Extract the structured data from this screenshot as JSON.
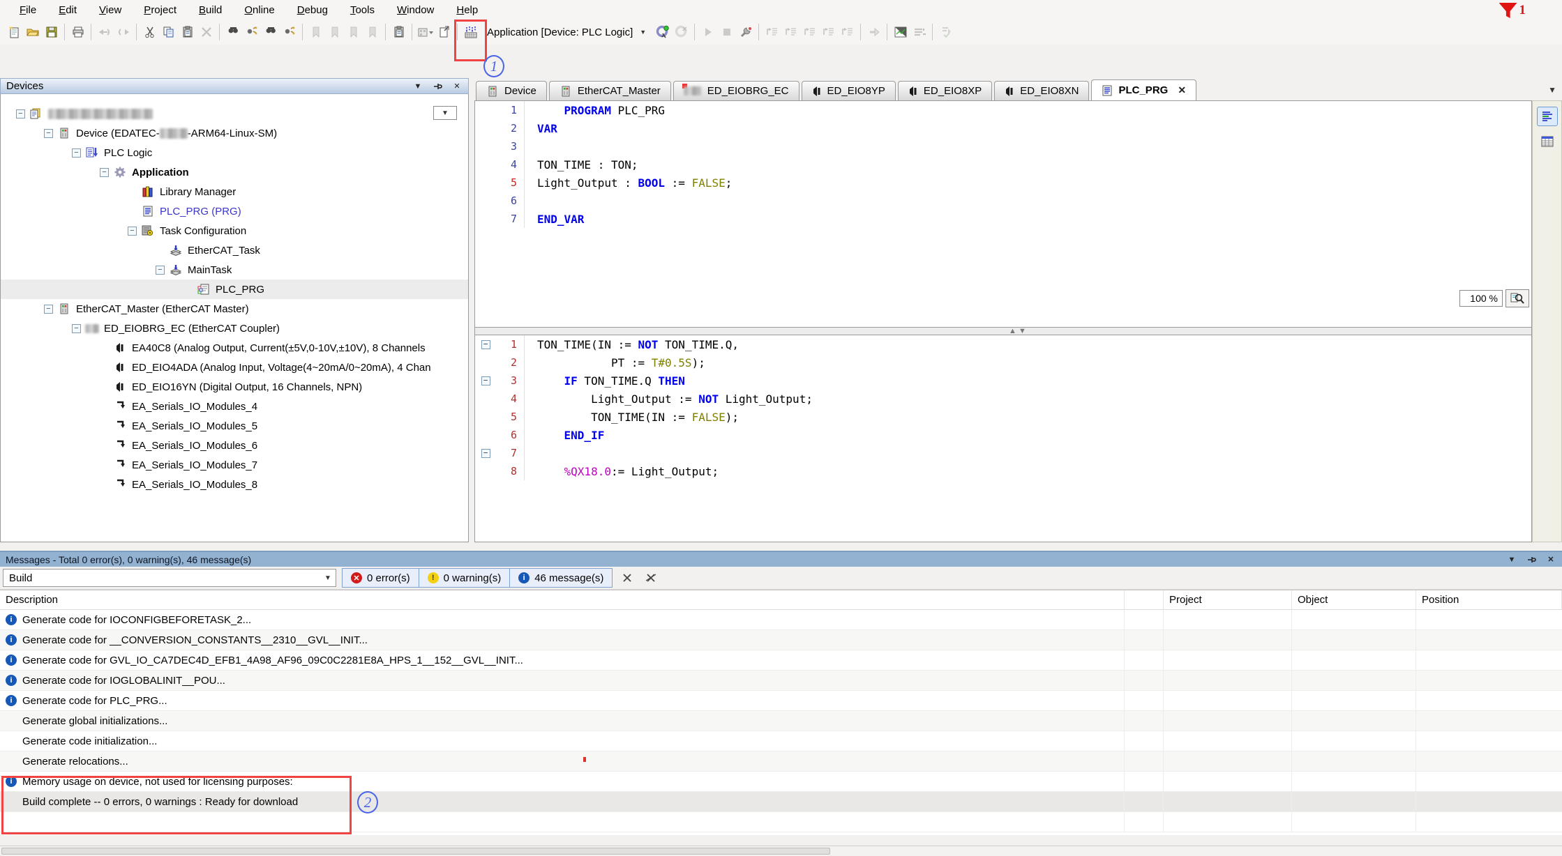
{
  "window": {
    "filter_badge": "1"
  },
  "annotations": {
    "callout_1": "1",
    "callout_2": "2"
  },
  "menubar": {
    "items": [
      "File",
      "Edit",
      "View",
      "Project",
      "Build",
      "Online",
      "Debug",
      "Tools",
      "Window",
      "Help"
    ]
  },
  "toolbar": {
    "application_selector": "Application [Device: PLC Logic]",
    "icons_before_build": [
      "new-file",
      "open-file",
      "save",
      "|",
      "print",
      "|",
      "undo",
      "redo",
      "|",
      "cut",
      "copy",
      "paste",
      "delete",
      "|",
      "find",
      "incremental-find",
      "find-in-project",
      "replace",
      "|",
      "bookmark-toggle",
      "bookmark-prev",
      "bookmark-next",
      "bookmark-clear",
      "|",
      "paste-special",
      "|",
      "new-object",
      "export",
      "|"
    ],
    "icons_after_selector": [
      "login",
      "logout",
      "|",
      "start",
      "stop",
      "online-config",
      "|",
      "step-over",
      "step-into",
      "step-out",
      "run-to-cursor",
      "reset-step",
      "|",
      "show-next-statement",
      "|",
      "flow-control",
      "force-values",
      "|",
      "write-values"
    ],
    "disabled_icons": [
      "undo",
      "redo",
      "delete",
      "bookmark-toggle",
      "bookmark-prev",
      "bookmark-next",
      "bookmark-clear",
      "logout",
      "start",
      "stop",
      "step-over",
      "step-into",
      "step-out",
      "run-to-cursor",
      "reset-step",
      "show-next-statement",
      "force-values",
      "write-values"
    ]
  },
  "devices_panel": {
    "title": "Devices",
    "tree": [
      {
        "level": 0,
        "icon": "project",
        "expander": true,
        "redacted_label": true,
        "combo": true
      },
      {
        "level": 1,
        "icon": "device",
        "expander": true,
        "pre": "Device (EDATEC-",
        "redacted_mid": true,
        "post": "-ARM64-Linux-SM)"
      },
      {
        "level": 2,
        "icon": "plclogic",
        "expander": true,
        "label": "PLC Logic"
      },
      {
        "level": 3,
        "icon": "application",
        "expander": true,
        "label": "Application",
        "bold": true
      },
      {
        "level": 4,
        "icon": "library",
        "expander": false,
        "label": "Library Manager"
      },
      {
        "level": 4,
        "icon": "pou",
        "expander": false,
        "label": "PLC_PRG (PRG)",
        "blue": true
      },
      {
        "level": 4,
        "icon": "taskconfig",
        "expander": true,
        "label": "Task Configuration"
      },
      {
        "level": 5,
        "icon": "task",
        "expander": false,
        "label": "EtherCAT_Task"
      },
      {
        "level": 5,
        "icon": "task",
        "expander": true,
        "label": "MainTask"
      },
      {
        "level": 6,
        "icon": "pou-call",
        "expander": false,
        "label": "PLC_PRG",
        "selected": true
      },
      {
        "level": 1,
        "icon": "device",
        "expander": true,
        "label": "EtherCAT_Master (EtherCAT Master)"
      },
      {
        "level": 2,
        "icon": "coupler",
        "expander": true,
        "label": "ED_EIOBRG_EC (EtherCAT Coupler)"
      },
      {
        "level": 3,
        "icon": "module",
        "expander": false,
        "label": "EA40C8 (Analog Output, Current(±5V,0-10V,±10V), 8 Channels"
      },
      {
        "level": 3,
        "icon": "module",
        "expander": false,
        "label": "ED_EIO4ADA (Analog Input, Voltage(4~20mA/0~20mA), 4 Chan"
      },
      {
        "level": 3,
        "icon": "module",
        "expander": false,
        "label": "ED_EIO16YN (Digital Output, 16 Channels, NPN)"
      },
      {
        "level": 3,
        "icon": "serial",
        "expander": false,
        "label": "EA_Serials_IO_Modules_4"
      },
      {
        "level": 3,
        "icon": "serial",
        "expander": false,
        "label": "EA_Serials_IO_Modules_5"
      },
      {
        "level": 3,
        "icon": "serial",
        "expander": false,
        "label": "EA_Serials_IO_Modules_6"
      },
      {
        "level": 3,
        "icon": "serial",
        "expander": false,
        "label": "EA_Serials_IO_Modules_7"
      },
      {
        "level": 3,
        "icon": "serial",
        "expander": false,
        "label": "EA_Serials_IO_Modules_8"
      }
    ]
  },
  "editor": {
    "tabs": [
      {
        "label": "Device",
        "icon": "device"
      },
      {
        "label": "EtherCAT_Master",
        "icon": "device"
      },
      {
        "label": "ED_EIOBRG_EC",
        "icon": "coupler",
        "marker": true
      },
      {
        "label": "ED_EIO8YP",
        "icon": "module"
      },
      {
        "label": "ED_EIO8XP",
        "icon": "module"
      },
      {
        "label": "ED_EIO8XN",
        "icon": "module"
      },
      {
        "label": "PLC_PRG",
        "icon": "pou",
        "active": true,
        "closable": true
      }
    ],
    "zoom_level": "100 %",
    "declaration": {
      "lines": [
        {
          "n": "1",
          "tokens": [
            [
              "p",
              "    "
            ],
            [
              "k",
              "PROGRAM"
            ],
            [
              "p",
              " PLC_PRG"
            ]
          ]
        },
        {
          "n": "2",
          "tokens": [
            [
              "k",
              "VAR"
            ]
          ]
        },
        {
          "n": "3",
          "tokens": []
        },
        {
          "n": "4",
          "tokens": [
            [
              "p",
              "TON_TIME : TON;"
            ]
          ]
        },
        {
          "n": "5",
          "hot": true,
          "tokens": [
            [
              "p",
              "Light_Output : "
            ],
            [
              "k",
              "BOOL"
            ],
            [
              "p",
              " := "
            ],
            [
              "l",
              "FALSE"
            ],
            [
              "p",
              ";"
            ]
          ]
        },
        {
          "n": "6",
          "tokens": []
        },
        {
          "n": "7",
          "tokens": [
            [
              "k",
              "END_VAR"
            ]
          ]
        }
      ]
    },
    "implementation": {
      "lines": [
        {
          "n": "1",
          "fold": true,
          "tokens": [
            [
              "p",
              "TON_TIME(IN := "
            ],
            [
              "k",
              "NOT"
            ],
            [
              "p",
              " TON_TIME.Q,"
            ]
          ]
        },
        {
          "n": "2",
          "tokens": [
            [
              "p",
              "           PT := "
            ],
            [
              "l",
              "T#0.5S"
            ],
            [
              "p",
              ");"
            ]
          ]
        },
        {
          "n": "3",
          "fold": true,
          "tokens": [
            [
              "p",
              "    "
            ],
            [
              "k",
              "IF"
            ],
            [
              "p",
              " TON_TIME.Q "
            ],
            [
              "k",
              "THEN"
            ]
          ]
        },
        {
          "n": "4",
          "tokens": [
            [
              "p",
              "        Light_Output := "
            ],
            [
              "k",
              "NOT"
            ],
            [
              "p",
              " Light_Output;"
            ]
          ]
        },
        {
          "n": "5",
          "tokens": [
            [
              "p",
              "        TON_TIME(IN := "
            ],
            [
              "l",
              "FALSE"
            ],
            [
              "p",
              ");"
            ]
          ]
        },
        {
          "n": "6",
          "tokens": [
            [
              "p",
              "    "
            ],
            [
              "k",
              "END_IF"
            ]
          ]
        },
        {
          "n": "7",
          "fold": true,
          "tokens": []
        },
        {
          "n": "8",
          "tokens": [
            [
              "p",
              "    "
            ],
            [
              "a",
              "%QX18.0"
            ],
            [
              "p",
              ":= Light_Output;"
            ]
          ]
        }
      ]
    }
  },
  "messages": {
    "title": "Messages - Total 0 error(s), 0 warning(s), 46 message(s)",
    "filter": "Build",
    "error_button": "0 error(s)",
    "warning_button": "0 warning(s)",
    "message_button": "46 message(s)",
    "columns": [
      "Description",
      "",
      "Project",
      "Object",
      "Position"
    ],
    "rows": [
      {
        "icon": "info",
        "text": "Generate code for IOCONFIGBEFORETASK_2...",
        "shade": false
      },
      {
        "icon": "info",
        "text": "Generate code for __CONVERSION_CONSTANTS__2310__GVL__INIT...",
        "shade": true
      },
      {
        "icon": "info",
        "text": "Generate code for GVL_IO_CA7DEC4D_EFB1_4A98_AF96_09C0C2281E8A_HPS_1__152__GVL__INIT...",
        "shade": false
      },
      {
        "icon": "info",
        "text": "Generate code for IOGLOBALINIT__POU...",
        "shade": true
      },
      {
        "icon": "info",
        "text": "Generate code for PLC_PRG...",
        "shade": false
      },
      {
        "icon": "none",
        "text": "Generate global initializations...",
        "shade": true
      },
      {
        "icon": "none",
        "text": "Generate code initialization...",
        "shade": false
      },
      {
        "icon": "none",
        "text": "Generate relocations...",
        "shade": true
      },
      {
        "icon": "info",
        "text": "Memory usage on device, not used for licensing purposes:",
        "shade": false
      },
      {
        "icon": "none",
        "text": "Build complete -- 0 errors, 0 warnings : Ready for download",
        "gray": true
      },
      {
        "icon": "none",
        "text": "",
        "shade": false
      }
    ]
  }
}
